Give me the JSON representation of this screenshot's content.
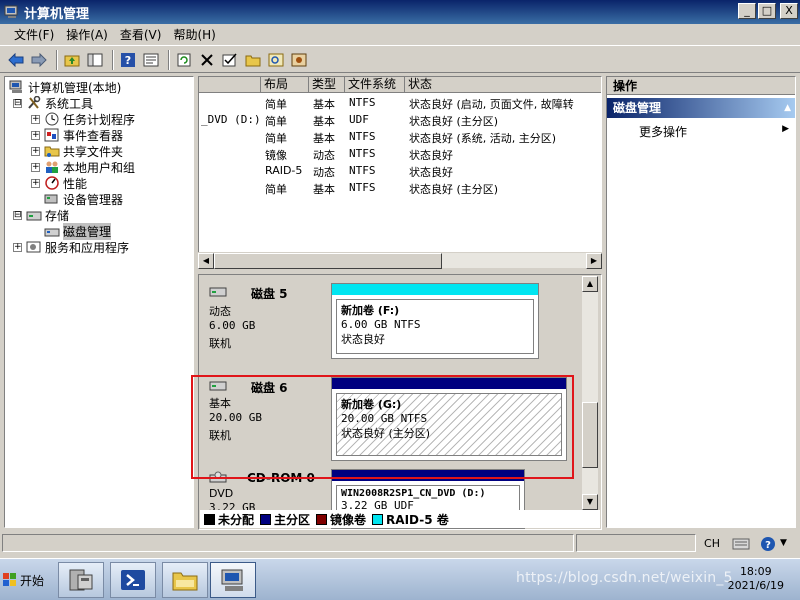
{
  "window": {
    "title": "计算机管理",
    "controls": [
      "_",
      "□",
      "X"
    ]
  },
  "menu": [
    "文件(F)",
    "操作(A)",
    "查看(V)",
    "帮助(H)"
  ],
  "toolbar_icons": [
    "back-icon",
    "forward-icon",
    "up-folder-icon",
    "console-tree-icon",
    "help-icon",
    "properties-icon",
    "refresh-icon",
    "delete-icon",
    "check-icon",
    "open-folder-icon",
    "search-icon",
    "settings-icon"
  ],
  "tree": {
    "root": "计算机管理(本地)",
    "items": [
      {
        "label": "系统工具",
        "level": 1,
        "expander": "⊟"
      },
      {
        "label": "任务计划程序",
        "level": 2,
        "expander": "+"
      },
      {
        "label": "事件查看器",
        "level": 2,
        "expander": "+"
      },
      {
        "label": "共享文件夹",
        "level": 2,
        "expander": "+"
      },
      {
        "label": "本地用户和组",
        "level": 2,
        "expander": "+"
      },
      {
        "label": "性能",
        "level": 2,
        "expander": "+"
      },
      {
        "label": "设备管理器",
        "level": 2,
        "expander": ""
      },
      {
        "label": "存储",
        "level": 1,
        "expander": "⊟"
      },
      {
        "label": "磁盘管理",
        "level": 2,
        "expander": ""
      },
      {
        "label": "服务和应用程序",
        "level": 1,
        "expander": "+"
      }
    ]
  },
  "volume_table": {
    "headers": [
      "布局",
      "类型",
      "文件系统",
      "状态"
    ],
    "rows": [
      {
        "volume": "",
        "layout": "简单",
        "type": "基本",
        "fs": "NTFS",
        "status": "状态良好 (启动, 页面文件, 故障转"
      },
      {
        "volume": "_DVD (D:)",
        "layout": "简单",
        "type": "基本",
        "fs": "UDF",
        "status": "状态良好 (主分区)"
      },
      {
        "volume": "",
        "layout": "简单",
        "type": "基本",
        "fs": "NTFS",
        "status": "状态良好 (系统, 活动, 主分区)"
      },
      {
        "volume": "",
        "layout": "镜像",
        "type": "动态",
        "fs": "NTFS",
        "status": "状态良好"
      },
      {
        "volume": "",
        "layout": "RAID-5",
        "type": "动态",
        "fs": "NTFS",
        "status": "状态良好"
      },
      {
        "volume": "",
        "layout": "简单",
        "type": "基本",
        "fs": "NTFS",
        "status": "状态良好 (主分区)"
      }
    ]
  },
  "disks": [
    {
      "name": "磁盘 5",
      "kind": "动态",
      "size": "6.00 GB",
      "state": "联机",
      "vol_title": "新加卷  (F:)",
      "vol_size": "6.00 GB NTFS",
      "vol_status": "状态良好",
      "bar_color": "#00e5f0"
    },
    {
      "name": "磁盘 6",
      "kind": "基本",
      "size": "20.00 GB",
      "state": "联机",
      "vol_title": "新加卷  (G:)",
      "vol_size": "20.00 GB NTFS",
      "vol_status": "状态良好 (主分区)",
      "bar_color": "#000080"
    },
    {
      "name": "CD-ROM 0",
      "kind": "DVD",
      "size": "3.22 GB",
      "state": "",
      "vol_title": "WIN2008R2SP1_CN_DVD  (D:)",
      "vol_size": "3.22 GB UDF",
      "vol_status": "",
      "bar_color": "#000080"
    }
  ],
  "legend": [
    {
      "label": "未分配",
      "color": "#000000"
    },
    {
      "label": "主分区",
      "color": "#000080"
    },
    {
      "label": "镜像卷",
      "color": "#800000"
    },
    {
      "label": "RAID-5 卷",
      "color": "#00e5f0"
    }
  ],
  "actions": {
    "header": "操作",
    "section": "磁盘管理",
    "items": [
      "更多操作"
    ]
  },
  "taskbar": {
    "start": "开始",
    "lang": "CH",
    "time": "18:09",
    "date": "2021/6/19",
    "watermark": "https://blog.csdn.net/weixin_5"
  },
  "highlight_color": "#e0151a"
}
